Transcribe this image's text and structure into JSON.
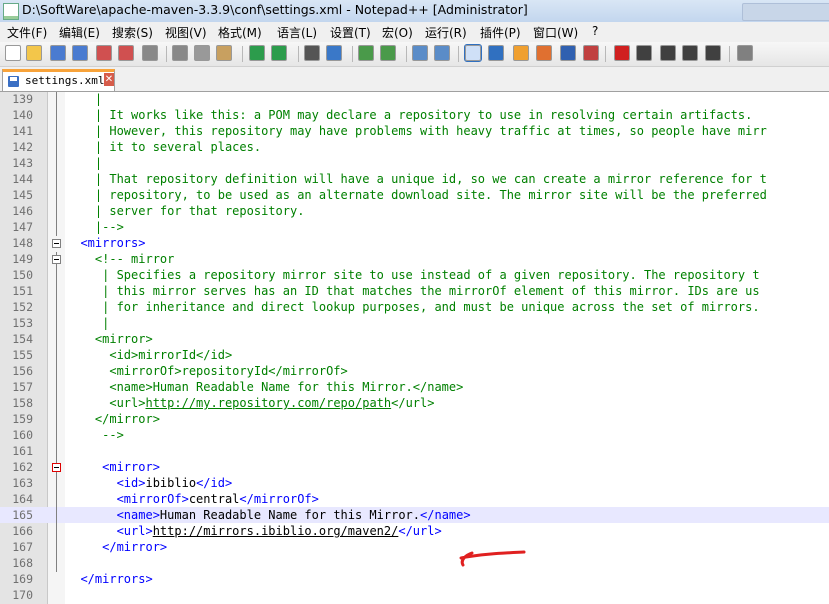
{
  "window": {
    "title": "D:\\SoftWare\\apache-maven-3.3.9\\conf\\settings.xml - Notepad++ [Administrator]"
  },
  "menu": [
    "文件(F)",
    "编辑(E)",
    "搜索(S)",
    "视图(V)",
    "格式(M)",
    "语言(L)",
    "设置(T)",
    "宏(O)",
    "运行(R)",
    "插件(P)",
    "窗口(W)",
    "?"
  ],
  "toolbar_icons": [
    "new-file-icon",
    "open-file-icon",
    "save-icon",
    "save-all-icon",
    "close-icon",
    "close-all-icon",
    "print-icon",
    "cut-icon",
    "copy-icon",
    "paste-icon",
    "undo-icon",
    "redo-icon",
    "find-icon",
    "replace-icon",
    "zoom-in-icon",
    "zoom-out-icon",
    "sync-v-icon",
    "sync-h-icon",
    "wrap-icon",
    "show-all-icon",
    "indent-guide-icon",
    "udl-icon",
    "doc-map-icon",
    "function-list-icon",
    "record-macro-icon",
    "stop-macro-icon",
    "play-macro-icon",
    "run-macro-multiple-icon",
    "save-macro-icon",
    "spellcheck-icon"
  ],
  "tab": {
    "label": "settings.xml",
    "close": "✕"
  },
  "lines": [
    {
      "num": "139",
      "segs": [
        {
          "t": "    |",
          "c": "com"
        }
      ]
    },
    {
      "num": "140",
      "segs": [
        {
          "t": "    | It works like this: a POM may declare a repository to use in resolving certain artifacts.",
          "c": "com"
        }
      ]
    },
    {
      "num": "141",
      "segs": [
        {
          "t": "    | However, this repository may have problems with heavy traffic at times, so people have mirr",
          "c": "com"
        }
      ]
    },
    {
      "num": "142",
      "segs": [
        {
          "t": "    | it to several places.",
          "c": "com"
        }
      ]
    },
    {
      "num": "143",
      "segs": [
        {
          "t": "    |",
          "c": "com"
        }
      ]
    },
    {
      "num": "144",
      "segs": [
        {
          "t": "    | That repository definition will have a unique id, so we can create a mirror reference for t",
          "c": "com"
        }
      ]
    },
    {
      "num": "145",
      "segs": [
        {
          "t": "    | repository, to be used as an alternate download site. The mirror site will be the preferred",
          "c": "com"
        }
      ]
    },
    {
      "num": "146",
      "segs": [
        {
          "t": "    | server for that repository.",
          "c": "com"
        }
      ]
    },
    {
      "num": "147",
      "segs": [
        {
          "t": "    |-->",
          "c": "com"
        }
      ]
    },
    {
      "num": "148",
      "segs": [
        {
          "t": "  <mirrors>",
          "c": "tag"
        }
      ]
    },
    {
      "num": "149",
      "segs": [
        {
          "t": "    <!-- mirror",
          "c": "com"
        }
      ]
    },
    {
      "num": "150",
      "segs": [
        {
          "t": "     | Specifies a repository mirror site to use instead of a given repository. The repository t",
          "c": "com"
        }
      ]
    },
    {
      "num": "151",
      "segs": [
        {
          "t": "     | this mirror serves has an ID that matches the mirrorOf element of this mirror. IDs are us",
          "c": "com"
        }
      ]
    },
    {
      "num": "152",
      "segs": [
        {
          "t": "     | for inheritance and direct lookup purposes, and must be unique across the set of mirrors.",
          "c": "com"
        }
      ]
    },
    {
      "num": "153",
      "segs": [
        {
          "t": "     |",
          "c": "com"
        }
      ]
    },
    {
      "num": "154",
      "segs": [
        {
          "t": "    <mirror>",
          "c": "com"
        }
      ]
    },
    {
      "num": "155",
      "segs": [
        {
          "t": "      <id>mirrorId</id>",
          "c": "com"
        }
      ]
    },
    {
      "num": "156",
      "segs": [
        {
          "t": "      <mirrorOf>repositoryId</mirrorOf>",
          "c": "com"
        }
      ]
    },
    {
      "num": "157",
      "segs": [
        {
          "t": "      <name>Human Readable Name for this Mirror.</name>",
          "c": "com"
        }
      ]
    },
    {
      "num": "158",
      "segs": [
        {
          "t": "      <url>",
          "c": "com"
        },
        {
          "t": "http://my.repository.com/repo/path",
          "c": "comurl"
        },
        {
          "t": "</url>",
          "c": "com"
        }
      ]
    },
    {
      "num": "159",
      "segs": [
        {
          "t": "    </mirror>",
          "c": "com"
        }
      ]
    },
    {
      "num": "160",
      "segs": [
        {
          "t": "     -->",
          "c": "com"
        }
      ]
    },
    {
      "num": "161",
      "segs": [
        {
          "t": "",
          "c": "com"
        }
      ]
    },
    {
      "num": "162",
      "segs": [
        {
          "t": "     <mirror>",
          "c": "tag"
        }
      ]
    },
    {
      "num": "163",
      "segs": [
        {
          "t": "       <id>",
          "c": "tag"
        },
        {
          "t": "ibiblio",
          "c": "txt"
        },
        {
          "t": "</id>",
          "c": "tag"
        }
      ]
    },
    {
      "num": "164",
      "segs": [
        {
          "t": "       <mirrorOf>",
          "c": "tag"
        },
        {
          "t": "central",
          "c": "txt"
        },
        {
          "t": "</mirrorOf>",
          "c": "tag"
        }
      ]
    },
    {
      "num": "165",
      "segs": [
        {
          "t": "       <name>",
          "c": "tag"
        },
        {
          "t": "Human Readable Name for this Mirror.",
          "c": "txt"
        },
        {
          "t": "</name>",
          "c": "tag"
        }
      ],
      "current": true
    },
    {
      "num": "166",
      "segs": [
        {
          "t": "       <url>",
          "c": "tag"
        },
        {
          "t": "http://mirrors.ibiblio.org/maven2/",
          "c": "url"
        },
        {
          "t": "</url>",
          "c": "tag"
        }
      ]
    },
    {
      "num": "167",
      "segs": [
        {
          "t": "     </mirror>",
          "c": "tag"
        }
      ]
    },
    {
      "num": "168",
      "segs": [
        {
          "t": "",
          "c": "com"
        }
      ]
    },
    {
      "num": "169",
      "segs": [
        {
          "t": "  </mirrors>",
          "c": "tag"
        }
      ]
    },
    {
      "num": "170",
      "segs": [
        {
          "t": "",
          "c": "com"
        }
      ]
    }
  ],
  "colors": {
    "comment": "#008000",
    "tag": "#0000ff",
    "text": "#000000",
    "current_line": "#e8e8ff",
    "annotation_arrow": "#e02020"
  }
}
